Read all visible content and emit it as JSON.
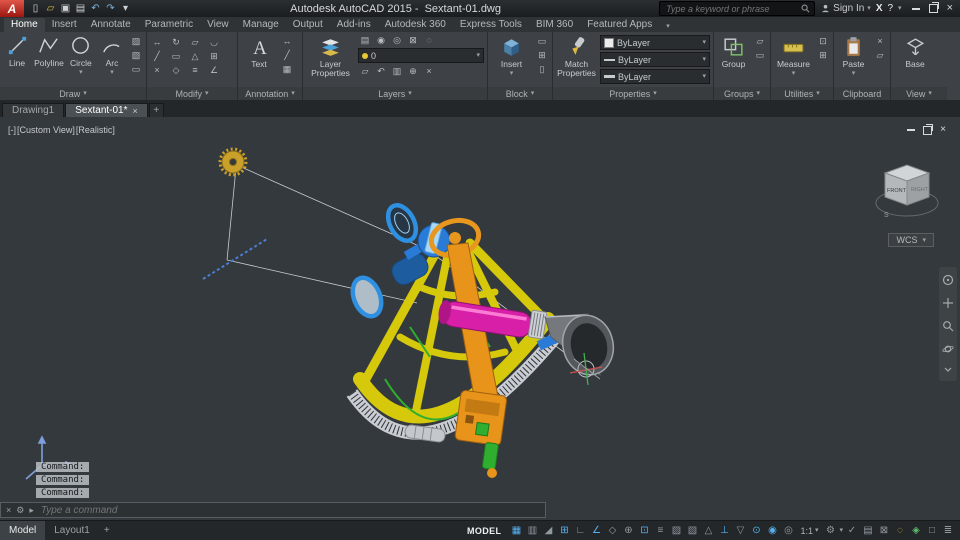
{
  "titlebar": {
    "title": "Autodesk AutoCAD 2015 -",
    "doc": "Sextant-01.dwg",
    "search_placeholder": "Type a keyword or phrase",
    "sign_in": "Sign In"
  },
  "ribbon_tabs": [
    "Home",
    "Insert",
    "Annotate",
    "Parametric",
    "View",
    "Manage",
    "Output",
    "Add-ins",
    "Autodesk 360",
    "Express Tools",
    "BIM 360",
    "Featured Apps"
  ],
  "ribbon": {
    "draw": {
      "label": "Draw",
      "tools": [
        "Line",
        "Polyline",
        "Circle",
        "Arc"
      ]
    },
    "modify": {
      "label": "Modify"
    },
    "annotation": {
      "label": "Annotation",
      "tool": "Text"
    },
    "layers": {
      "label": "Layers",
      "tool": "Layer Properties",
      "layer_value": "0"
    },
    "block": {
      "label": "Block",
      "tool": "Insert"
    },
    "properties": {
      "label": "Properties",
      "tool": "Match Properties",
      "object_color": "ByLayer",
      "linetype": "ByLayer",
      "lineweight": "ByLayer"
    },
    "groups": {
      "label": "Groups",
      "tool": "Group"
    },
    "utilities": {
      "label": "Utilities",
      "tool": "Measure"
    },
    "clipboard": {
      "label": "Clipboard",
      "tool": "Paste"
    },
    "view": {
      "label": "View",
      "tool": "Base"
    }
  },
  "file_tabs": [
    "Drawing1",
    "Sextant-01*"
  ],
  "viewport": {
    "minimize": "[-]",
    "view": "[Custom View]",
    "style": "[Realistic]",
    "front": "FRONT",
    "right": "RIGHT",
    "compass": "S",
    "wcs": "WCS"
  },
  "command": {
    "history": [
      "Command:",
      "Command:",
      "Command:"
    ],
    "placeholder": "Type a command"
  },
  "statusbar": {
    "model": "MODEL",
    "layouts": [
      "Model",
      "Layout1"
    ],
    "scale": "1:1",
    "icons": [
      {
        "name": "grid",
        "glyph": "▦"
      },
      {
        "name": "snap",
        "glyph": "▥"
      },
      {
        "name": "infer-constraints",
        "glyph": "◢"
      },
      {
        "name": "dynamic-input",
        "glyph": "⊞"
      },
      {
        "name": "ortho",
        "glyph": "∟"
      },
      {
        "name": "polar-tracking",
        "glyph": "∠"
      },
      {
        "name": "isometric-drafting",
        "glyph": "◇"
      },
      {
        "name": "osnap-tracking",
        "glyph": "⊕"
      },
      {
        "name": "osnap",
        "glyph": "⊡"
      },
      {
        "name": "lineweight",
        "glyph": "≡"
      },
      {
        "name": "transparency",
        "glyph": "▨"
      },
      {
        "name": "selection-cycling",
        "glyph": "▧"
      },
      {
        "name": "3d-osnap",
        "glyph": "△"
      },
      {
        "name": "dynamic-ucs",
        "glyph": "⊥"
      },
      {
        "name": "selection-filtering",
        "glyph": "▽"
      },
      {
        "name": "gizmo",
        "glyph": "⊙"
      },
      {
        "name": "annotation-visibility",
        "glyph": "◉"
      },
      {
        "name": "autoscale",
        "glyph": "◎"
      },
      {
        "name": "workspace",
        "glyph": "⚙"
      },
      {
        "name": "annotation-monitor",
        "glyph": "✓"
      },
      {
        "name": "quick-properties",
        "glyph": "▤"
      },
      {
        "name": "lock-ui",
        "glyph": "⊠"
      },
      {
        "name": "isolate-objects",
        "glyph": "◌"
      },
      {
        "name": "graphics-performance",
        "glyph": "◈"
      },
      {
        "name": "clean-screen",
        "glyph": "□"
      },
      {
        "name": "customization",
        "glyph": "≣"
      }
    ]
  },
  "colors": {
    "canvas_bg": "#34393d",
    "frame_yellow": "#d6c80a",
    "arm_orange": "#e8941a",
    "handle_magenta": "#d81fa8",
    "mirror_blue": "#2f8fe0",
    "limb_silver": "#c9ccd2",
    "accent_green": "#2fae2f"
  }
}
